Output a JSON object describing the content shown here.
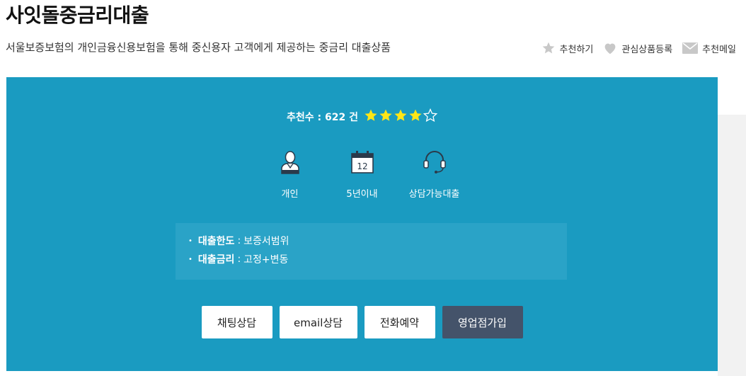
{
  "header": {
    "title": "사잇돌중금리대출",
    "subtitle": "서울보증보험의 개인금융신용보험을 통해 중신용자 고객에게 제공하는 중금리 대출상품"
  },
  "actions": [
    {
      "icon": "star-icon",
      "label": "추천하기"
    },
    {
      "icon": "heart-icon",
      "label": "관심상품등록"
    },
    {
      "icon": "mail-icon",
      "label": "추천메일"
    }
  ],
  "recommend": {
    "label": "추천수 : 622 건",
    "rating": 4,
    "max_rating": 5
  },
  "features": [
    {
      "icon": "person-icon",
      "label": "개인"
    },
    {
      "icon": "calendar-icon",
      "label": "5년이내",
      "calendar_day": "12"
    },
    {
      "icon": "headset-icon",
      "label": "상담가능대출"
    }
  ],
  "info": [
    {
      "key": "대출한도",
      "sep": ":",
      "value": "보증서범위"
    },
    {
      "key": "대출금리",
      "sep": ":",
      "value": "고정+변동"
    }
  ],
  "buttons": {
    "chat": "채팅상담",
    "email": "email상담",
    "phone": "전화예약",
    "branch": "영업점가입"
  },
  "colors": {
    "panel": "#1a9bc1",
    "info_box": "#2aa3c7",
    "star_fill": "#ffe617",
    "dark_button": "#44536a"
  }
}
